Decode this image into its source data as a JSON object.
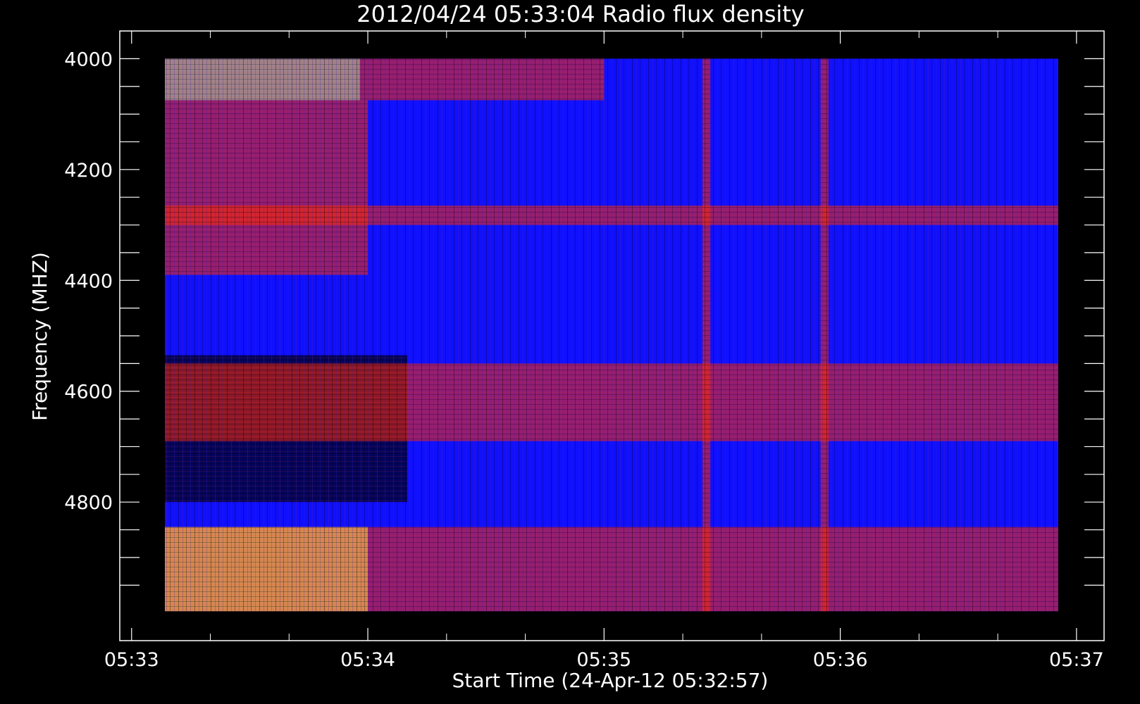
{
  "chart_data": {
    "type": "heatmap",
    "title": "2012/04/24 05:33:04 Radio flux density",
    "xlabel": "Start Time (24-Apr-12 05:32:57)",
    "ylabel": "Frequency (MHZ)",
    "x_range": [
      "05:32:57",
      "05:37:07"
    ],
    "y_range": [
      3950,
      5050
    ],
    "data_x_range": [
      "05:33:04",
      "05:37:04"
    ],
    "data_y_range": [
      4000,
      4997
    ],
    "x_ticks": [
      "05:33",
      "05:34",
      "05:35",
      "05:36",
      "05:37"
    ],
    "y_ticks": [
      4000,
      4200,
      4400,
      4600,
      4800
    ],
    "colors": {
      "background": "#000000",
      "axes": "#ffffff",
      "base": "#1010ff",
      "hot": "#ff2a00",
      "peak": "#ffd040",
      "low": "#000018"
    },
    "intensity_regions": [
      {
        "t_start": "05:33:04",
        "t_end": "05:33:58",
        "f_start": 4000,
        "f_end": 4075,
        "level": "peak"
      },
      {
        "t_start": "05:33:58",
        "t_end": "05:35:00",
        "f_start": 4000,
        "f_end": 4075,
        "level": "high"
      },
      {
        "t_start": "05:33:04",
        "t_end": "05:34:00",
        "f_start": 4075,
        "f_end": 4390,
        "level": "high"
      },
      {
        "t_start": "05:33:04",
        "t_end": "05:37:04",
        "f_start": 4265,
        "f_end": 4300,
        "level": "high"
      },
      {
        "t_start": "05:33:04",
        "t_end": "05:34:10",
        "f_start": 4535,
        "f_end": 4800,
        "level": "low"
      },
      {
        "t_start": "05:33:04",
        "t_end": "05:37:04",
        "f_start": 4550,
        "f_end": 4690,
        "level": "high"
      },
      {
        "t_start": "05:33:04",
        "t_end": "05:37:04",
        "f_start": 4845,
        "f_end": 4997,
        "level": "high"
      },
      {
        "t_start": "05:33:04",
        "t_end": "05:34:00",
        "f_start": 4845,
        "f_end": 4997,
        "level": "peak"
      },
      {
        "t_start": "05:35:25",
        "t_end": "05:35:27",
        "f_start": 4000,
        "f_end": 4997,
        "level": "high"
      },
      {
        "t_start": "05:35:55",
        "t_end": "05:35:57",
        "f_start": 4000,
        "f_end": 4997,
        "level": "high"
      }
    ]
  }
}
